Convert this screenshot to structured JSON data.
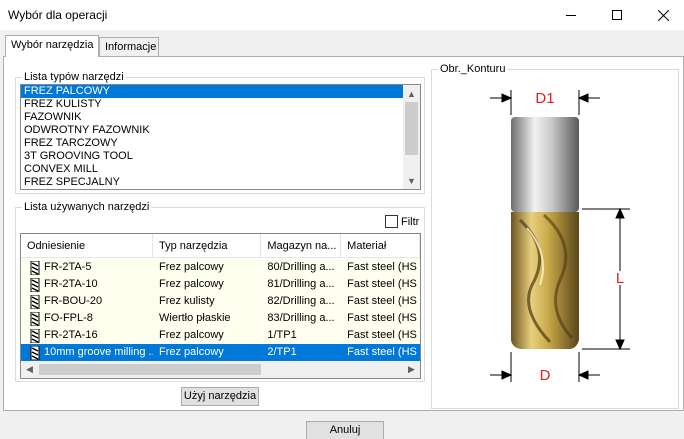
{
  "window": {
    "title": "Wybór dla operacji"
  },
  "tabs": [
    {
      "label": "Wybór narzędzia"
    },
    {
      "label": "Informacje"
    }
  ],
  "tool_types": {
    "label": "Lista typów narzędzi",
    "items": [
      "FREZ PALCOWY",
      "FREZ KULISTY",
      "FAZOWNIK",
      "ODWROTNY FAZOWNIK",
      "FREZ TARCZOWY",
      "3T GROOVING TOOL",
      "CONVEX MILL",
      "FREZ SPECJALNY"
    ],
    "selected": "FREZ PALCOWY"
  },
  "used_tools": {
    "label": "Lista używanych narzędzi",
    "filter_label": "Filtr",
    "columns": [
      "Odniesienie",
      "Typ narzędzia",
      "Magazyn na...",
      "Materiał"
    ],
    "rows": [
      {
        "ref": "FR-2TA-5",
        "type": "Frez palcowy",
        "mag": "80/Drilling a...",
        "mat": "Fast steel (HS"
      },
      {
        "ref": "FR-2TA-10",
        "type": "Frez palcowy",
        "mag": "81/Drilling a...",
        "mat": "Fast steel (HS"
      },
      {
        "ref": "FR-BOU-20",
        "type": "Frez kulisty",
        "mag": "82/Drilling a...",
        "mat": "Fast steel (HS"
      },
      {
        "ref": "FO-FPL-8",
        "type": "Wiertło płaskie",
        "mag": "83/Drilling a...",
        "mat": "Fast steel (HS"
      },
      {
        "ref": "FR-2TA-16",
        "type": "Frez palcowy",
        "mag": "1/TP1",
        "mat": "Fast steel (HS"
      },
      {
        "ref": "10mm groove milling ...",
        "type": "Frez palcowy",
        "mag": "2/TP1",
        "mat": "Fast steel (HS"
      }
    ],
    "selected_row": 5
  },
  "buttons": {
    "use": "Użyj narzędzia",
    "cancel": "Anuluj"
  },
  "contour": {
    "label": "Obr._Konturu",
    "d1": "D1",
    "l": "L",
    "d": "D",
    "dim_color": "#e02020"
  }
}
